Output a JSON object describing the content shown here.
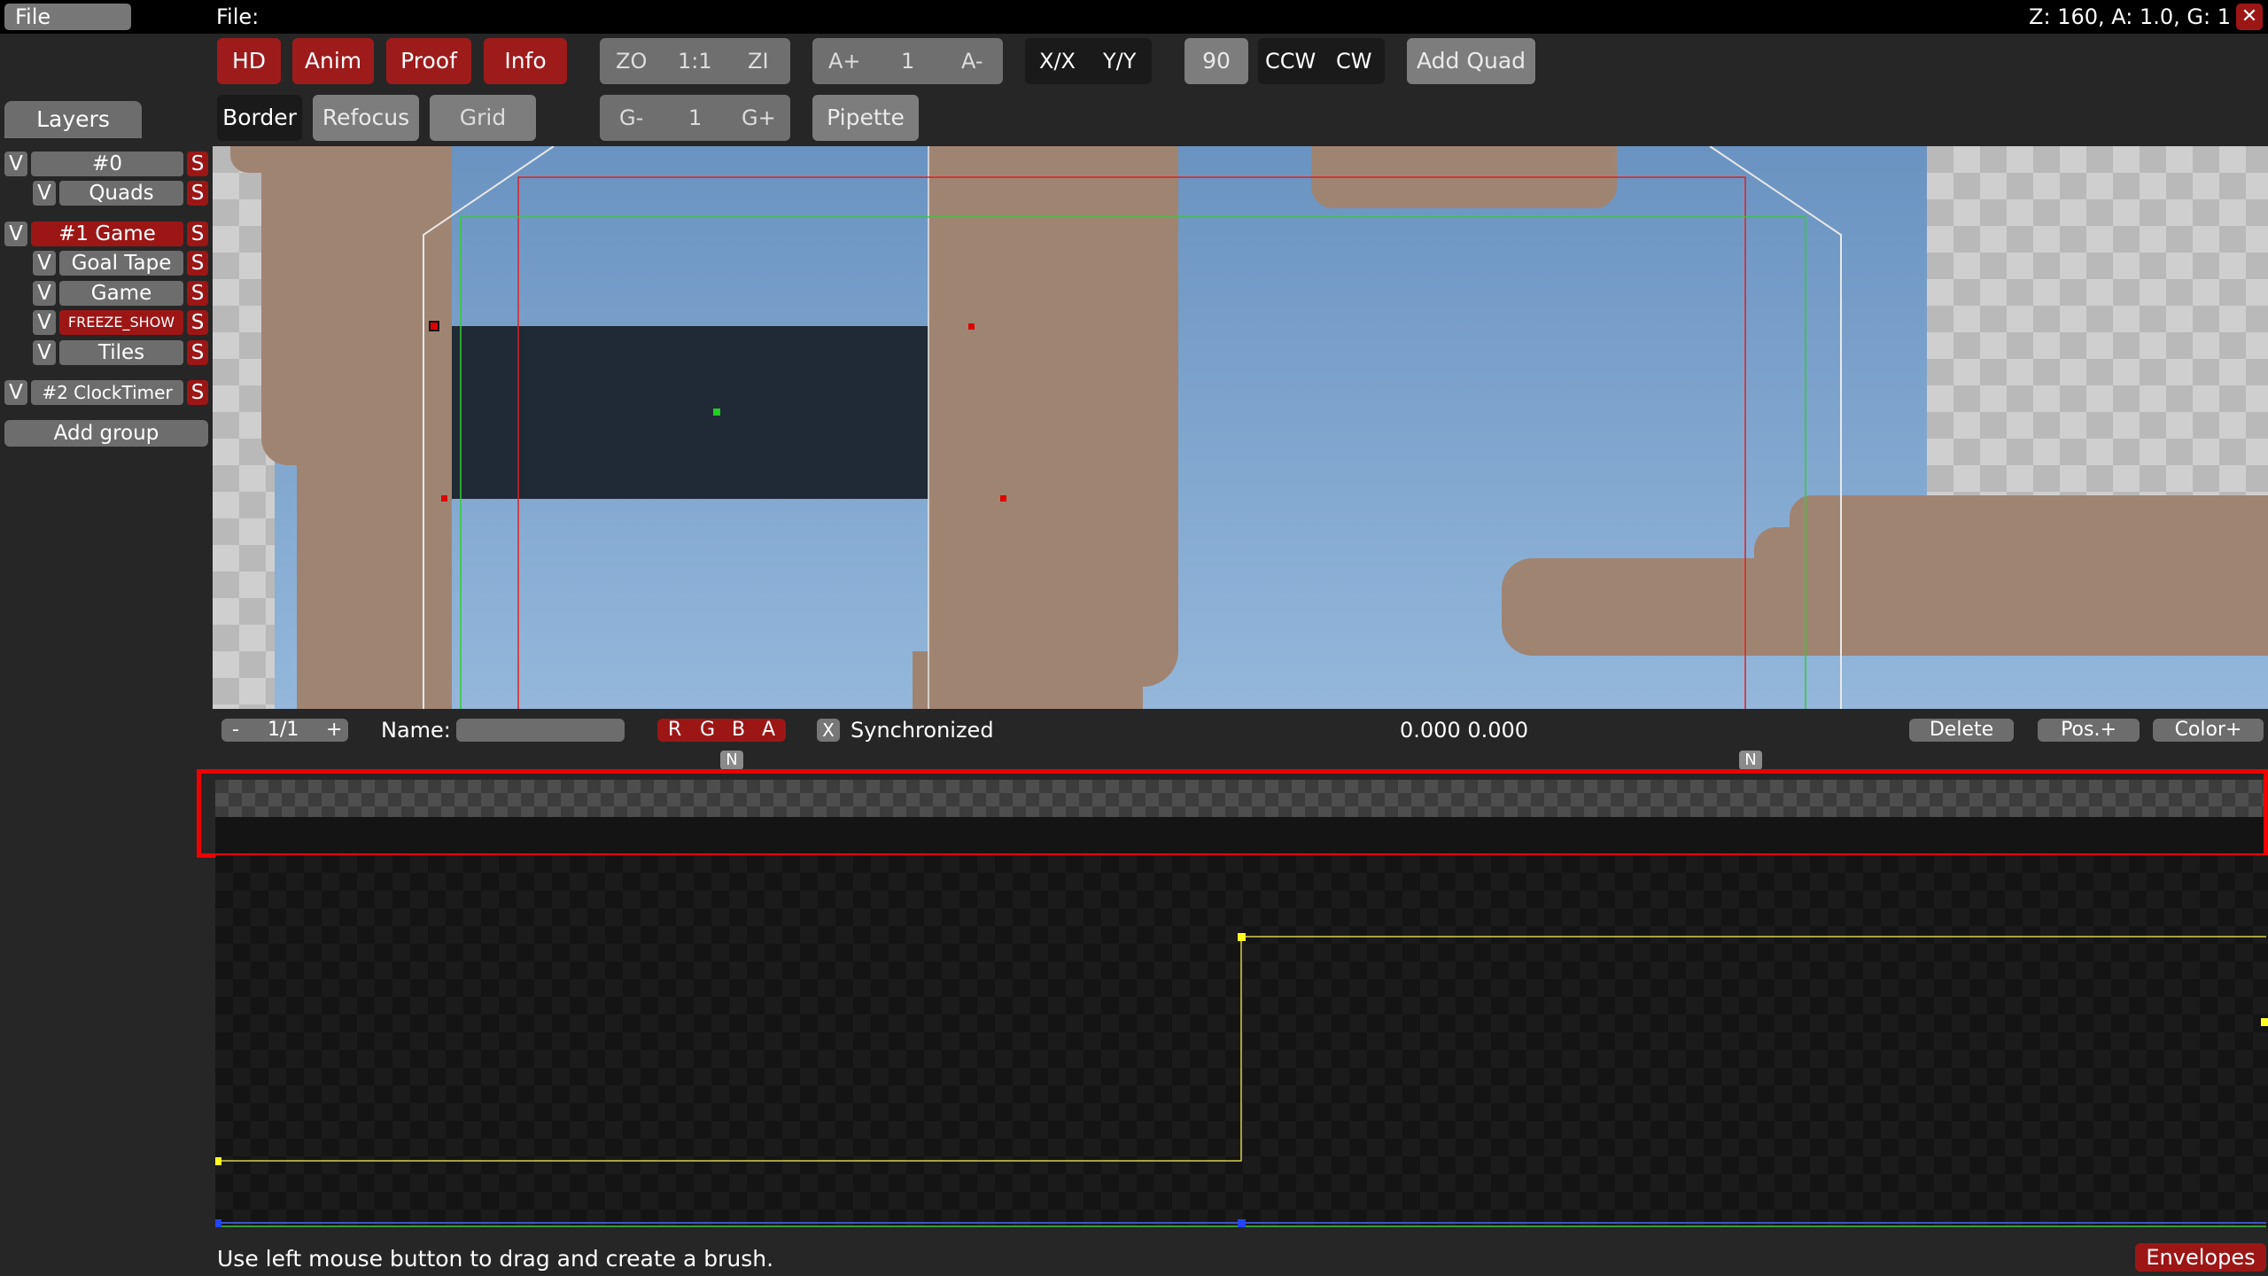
{
  "menubar": {
    "file_menu": "File",
    "file_label": "File:",
    "status": "Z: 160, A: 1.0, G: 1",
    "close": "✕"
  },
  "toolbar": {
    "row1": {
      "hd": "HD",
      "anim": "Anim",
      "proof": "Proof",
      "info": "Info",
      "zoom_out": "ZO",
      "zoom_reset": "1:1",
      "zoom_in": "ZI",
      "anim_faster": "A+",
      "anim_value": "1",
      "anim_slower": "A-",
      "flip_x": "X/X",
      "flip_y": "Y/Y",
      "rotate_amount": "90",
      "ccw": "CCW",
      "cw": "CW",
      "add_quad": "Add Quad"
    },
    "row2": {
      "border": "Border",
      "refocus": "Refocus",
      "grid": "Grid",
      "grid_decrease": "G-",
      "grid_value": "1",
      "grid_increase": "G+",
      "pipette": "Pipette"
    }
  },
  "layers": {
    "tab": "Layers",
    "rows": [
      {
        "v": "V",
        "name": "#0",
        "s": "S"
      },
      {
        "v": "V",
        "name": "Quads",
        "s": "S"
      },
      {
        "v": "V",
        "name": "#1 Game",
        "s": "S"
      },
      {
        "v": "V",
        "name": "Goal Tape",
        "s": "S"
      },
      {
        "v": "V",
        "name": "Game",
        "s": "S"
      },
      {
        "v": "V",
        "name": "FREEZE_SHOW",
        "s": "S"
      },
      {
        "v": "V",
        "name": "Tiles",
        "s": "S"
      },
      {
        "v": "V",
        "name": "#2 ClockTimer",
        "s": "S"
      }
    ],
    "add_group": "Add group"
  },
  "envelope_bar": {
    "prev": "-",
    "page": "1/1",
    "next": "+",
    "name_label": "Name:",
    "name_value": "",
    "channels": [
      "R",
      "G",
      "B",
      "A"
    ],
    "sync_check": "X",
    "sync_label": "Synchronized",
    "coords": "0.000 0.000",
    "delete": "Delete",
    "pos_plus": "Pos.+",
    "color_plus": "Color+",
    "marker_left": "N",
    "marker_right": "N"
  },
  "status_bar": {
    "hint": "Use left mouse button to drag and create a brush.",
    "envelopes": "Envelopes"
  },
  "colors": {
    "active_red": "#9e1b1b",
    "toggle_gray": "#6f6f6f",
    "curve_yellow": "#d8d24a",
    "highlight": "#e00000"
  }
}
